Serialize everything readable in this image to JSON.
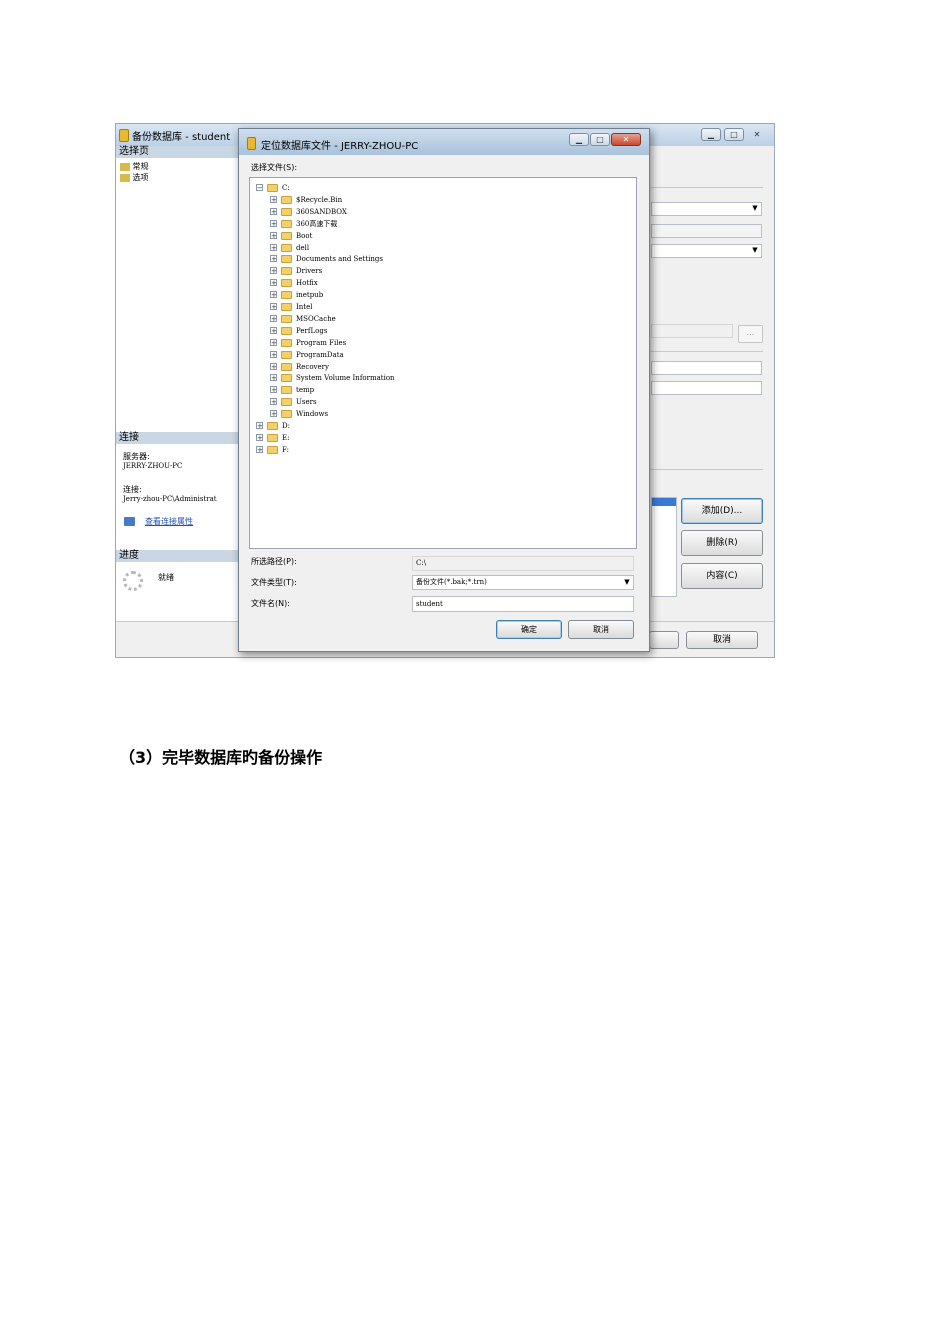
{
  "back_window": {
    "title": "备份数据库 - student",
    "select_page_header": "选择页",
    "pages": [
      "常规",
      "选项"
    ],
    "connection_header": "连接",
    "server_label": "服务器:",
    "server_value": "JERRY-ZHOU-PC",
    "connection_label": "连接:",
    "connection_value": "Jerry-zhou-PC\\Administrat",
    "view_conn_link": "查看连接属性",
    "progress_header": "进度",
    "progress_status": "就绪",
    "browse_label": "...",
    "add_button": "添加(D)...",
    "remove_button": "删除(R)",
    "contents_button": "内容(C)",
    "cancel_button": "取消"
  },
  "dialog": {
    "title": "定位数据库文件 - JERRY-ZHOU-PC",
    "select_file_label": "选择文件(S):",
    "tree": {
      "root": "C:",
      "children": [
        "$Recycle.Bin",
        "360SANDBOX",
        "360高速下载",
        "Boot",
        "dell",
        "Documents and Settings",
        "Drivers",
        "Hotfix",
        "inetpub",
        "Intel",
        "MSOCache",
        "PerfLogs",
        "Program Files",
        "ProgramData",
        "Recovery",
        "System Volume Information",
        "temp",
        "Users",
        "Windows"
      ],
      "other_roots": [
        "D:",
        "E:",
        "F:"
      ]
    },
    "selected_path_label": "所选路径(P):",
    "selected_path_value": "C:\\",
    "file_type_label": "文件类型(T):",
    "file_type_value": "备份文件(*.bak;*.trn)",
    "file_name_label": "文件名(N):",
    "file_name_value": "student",
    "ok_button": "确定",
    "cancel_button": "取消"
  },
  "caption": "（3）完毕数据库旳备份操作"
}
